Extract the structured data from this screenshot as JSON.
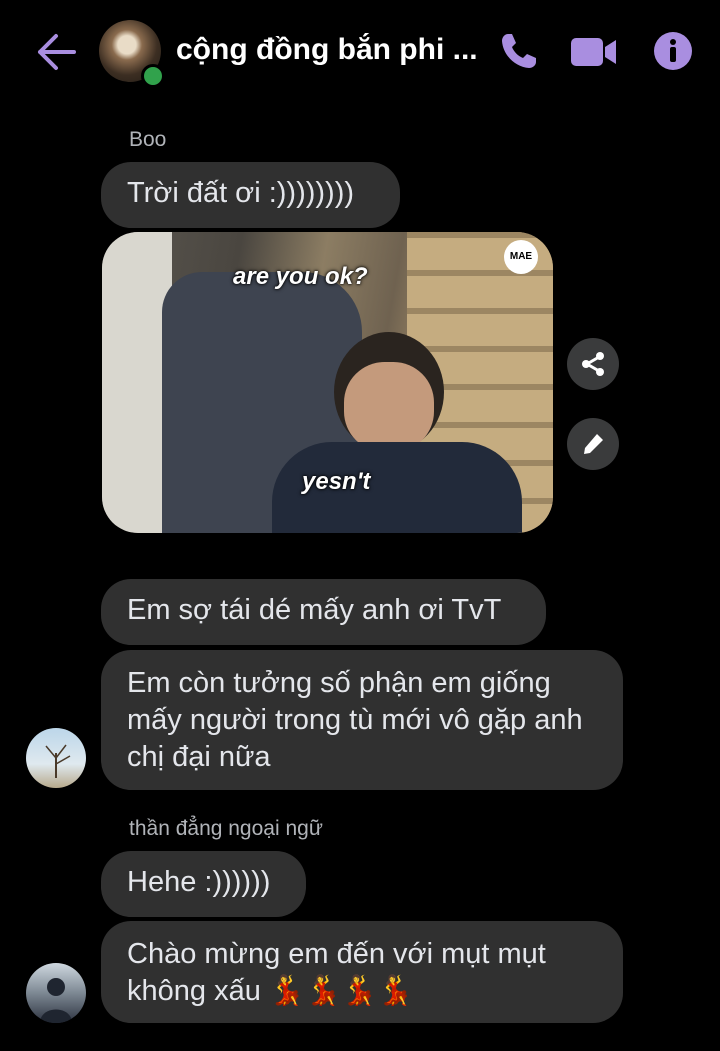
{
  "header": {
    "title": "cộng đồng bắn phi ...",
    "accent_color": "#a98ee0",
    "icons": [
      "back-arrow-icon",
      "phone-icon",
      "video-camera-icon",
      "info-icon"
    ]
  },
  "messages": {
    "group1": {
      "sender": "Boo",
      "text1": "Trời đất ơi :))))))))",
      "image": {
        "caption_top": "are you ok?",
        "caption_bottom": "yesn't",
        "watermark": "MAE"
      },
      "text2": "Em sợ tái dé mấy anh ơi TvT",
      "text3": "Em còn tưởng số phận em giống mấy người trong tù mới vô gặp anh chị đại nữa"
    },
    "group2": {
      "sender": "thần đẳng ngoại ngữ",
      "text1": "Hehe :))))))",
      "text2": "Chào mừng em đến với mụt mụt không xấu 💃💃💃💃"
    }
  }
}
